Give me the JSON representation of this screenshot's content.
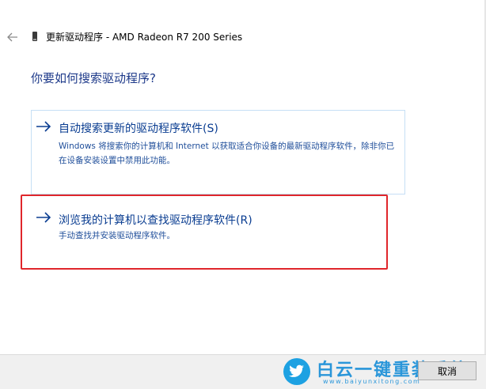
{
  "header": {
    "title": "更新驱动程序 - AMD Radeon R7 200 Series"
  },
  "main": {
    "question": "你要如何搜索驱动程序?",
    "options": [
      {
        "title": "自动搜索更新的驱动程序软件(S)",
        "description": "Windows 将搜索你的计算机和 Internet 以获取适合你设备的最新驱动程序软件，除非你已在设备安装设置中禁用此功能。"
      },
      {
        "title": "浏览我的计算机以查找驱动程序软件(R)",
        "description": "手动查找并安装驱动程序软件。"
      }
    ]
  },
  "footer": {
    "cancel_label": "取消"
  },
  "watermark": {
    "name": "白云一键重装系统",
    "url": "www.baiyunxitong.com"
  },
  "colors": {
    "accent": "#0a3d91",
    "highlight": "#e0262b",
    "option_border": "#c6dff5"
  }
}
